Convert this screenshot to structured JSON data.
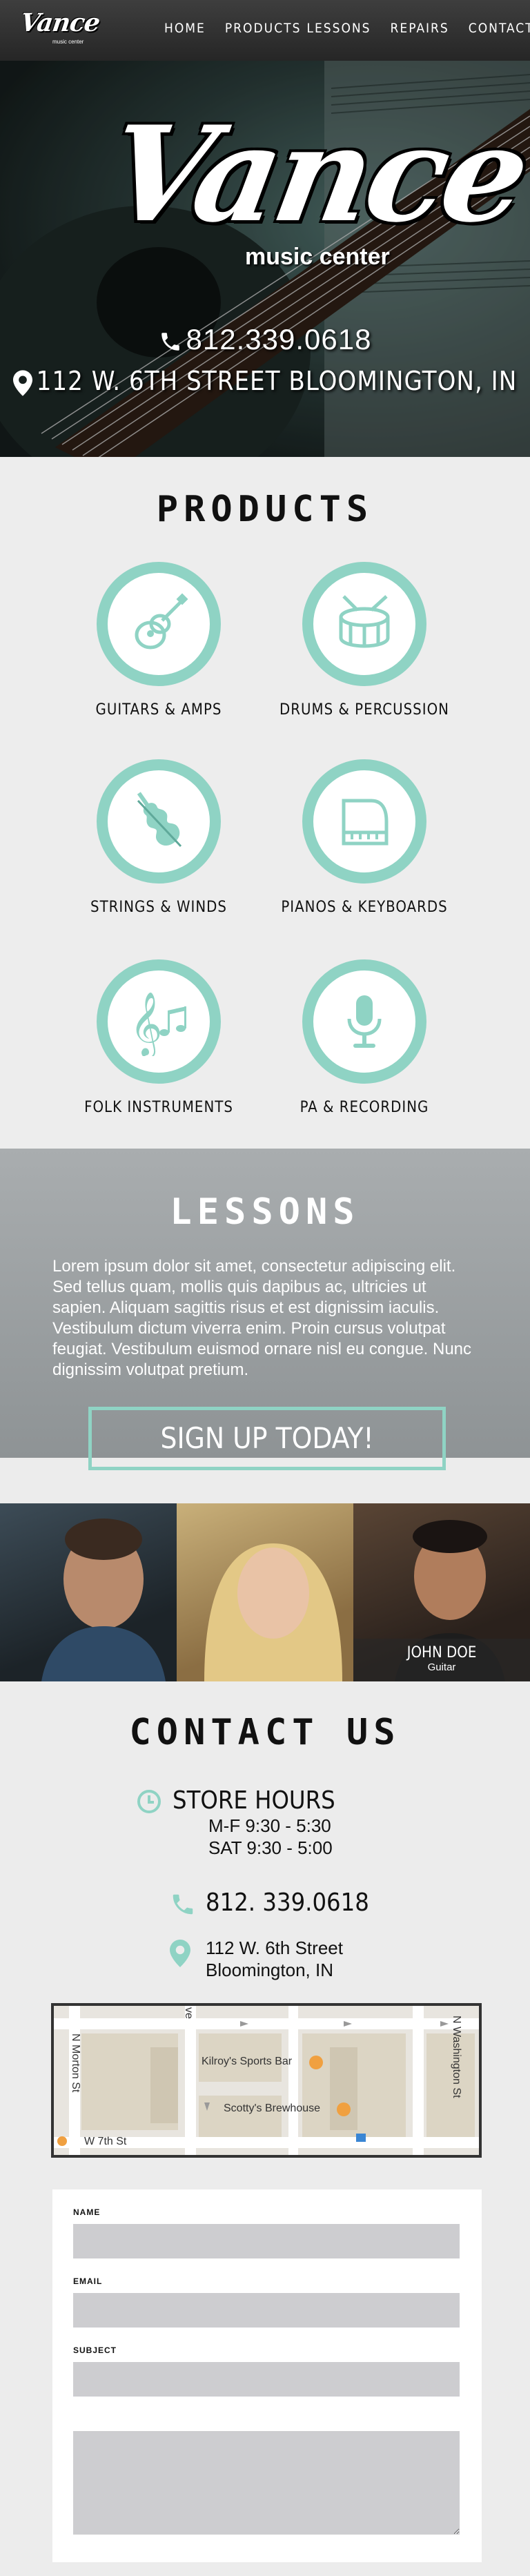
{
  "nav": {
    "logo_text": "Vance",
    "logo_sub": "music center",
    "links": [
      "HOME",
      "PRODUCTS",
      "LESSONS",
      "REPAIRS",
      "CONTACT"
    ]
  },
  "hero": {
    "logo_text": "Vance",
    "logo_sub": "music center",
    "phone": "812.339.0618",
    "address": "112 W. 6TH STREET BLOOMINGTON, IN"
  },
  "products": {
    "title": "PRODUCTS",
    "items": [
      {
        "label": "GUITARS & AMPS",
        "icon": "guitar-icon"
      },
      {
        "label": "DRUMS & PERCUSSION",
        "icon": "drum-icon"
      },
      {
        "label": "STRINGS & WINDS",
        "icon": "violin-icon"
      },
      {
        "label": "PIANOS & KEYBOARDS",
        "icon": "piano-icon"
      },
      {
        "label": "FOLK INSTRUMENTS",
        "icon": "music-notes-icon"
      },
      {
        "label": "PA & RECORDING",
        "icon": "microphone-icon"
      }
    ],
    "accent": "#8fd3c4"
  },
  "lessons": {
    "title": "LESSONS",
    "text": "Lorem ipsum dolor sit amet, consectetur adipiscing elit. Sed tellus quam, mollis quis dapibus ac, ultricies ut sapien. Aliquam sagittis risus et est dignissim iaculis. Vestibulum dictum viverra enim. Proin cursus volutpat feugiat. Vestibulum euismod ornare nisl eu congue. Nunc dignissim volutpat pretium.",
    "signup_label": "SIGN UP TODAY!"
  },
  "teachers": [
    {
      "name": "",
      "role": ""
    },
    {
      "name": "",
      "role": ""
    },
    {
      "name": "JOHN DOE",
      "role": "Guitar"
    }
  ],
  "contact": {
    "title": "CONTACT US",
    "hours_heading": "STORE HOURS",
    "hours": [
      "M-F 9:30 - 5:30",
      "SAT 9:30 - 5:00"
    ],
    "phone": "812. 339.0618",
    "address_line1": "112 W. 6th Street",
    "address_line2": "Bloomington, IN"
  },
  "map": {
    "streets": [
      "N Morton St",
      "N Washington St",
      "W 7th St",
      "ve"
    ],
    "places": [
      "Kilroy's Sports Bar",
      "Scotty's Brewhouse"
    ]
  },
  "form": {
    "name_label": "NAME",
    "email_label": "EMAIL",
    "subject_label": "SUBJECT"
  }
}
